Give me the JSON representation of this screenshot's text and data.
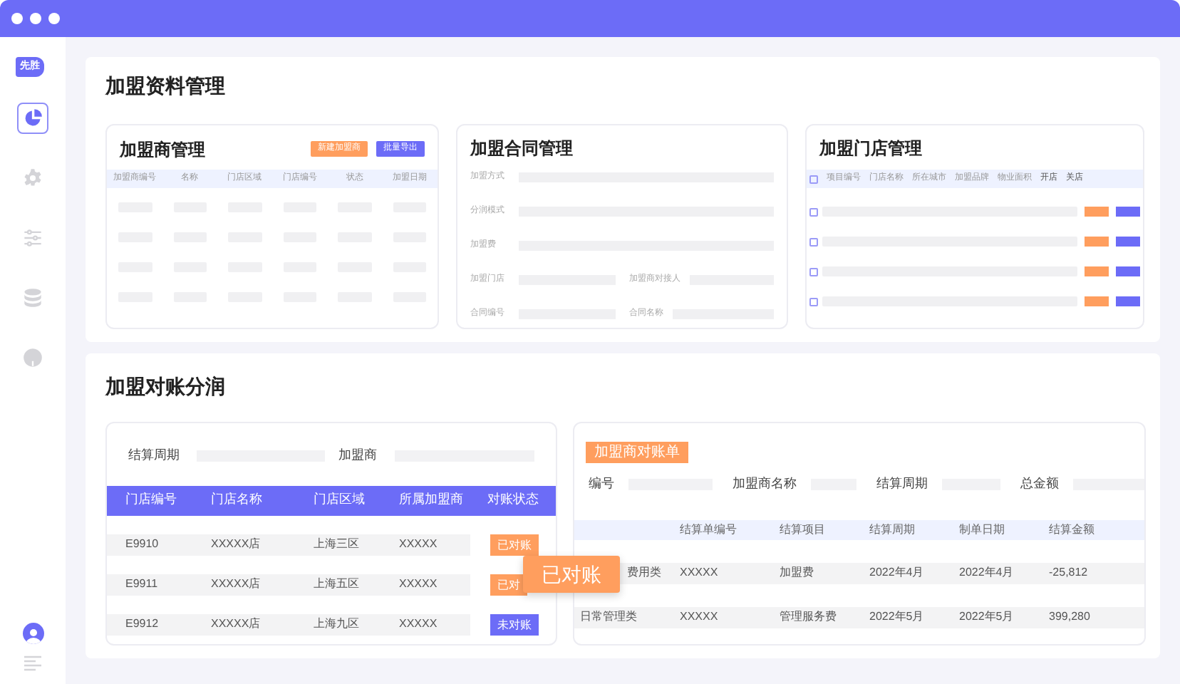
{
  "sidebar": {
    "logo": "先胜",
    "items": [
      {
        "selected": true
      },
      {
        "selected": false
      },
      {
        "selected": false
      },
      {
        "selected": false
      },
      {
        "selected": false
      }
    ]
  },
  "profile": {
    "selected": true
  },
  "section_1": {
    "title": "加盟资料管理",
    "franchisees": {
      "title": "加盟商管理",
      "buttons": [
        {
          "label": "新建加盟商",
          "kind": "secondary"
        },
        {
          "label": "批量导出",
          "kind": "primary"
        }
      ],
      "columns": [
        "加盟商编号",
        "名称",
        "门店区域",
        "门店编号",
        "状态",
        "加盟日期"
      ]
    },
    "contracts": {
      "title": "加盟合同管理",
      "fields": [
        [
          "加盟方式"
        ],
        [
          "分润模式"
        ],
        [
          "加盟费"
        ],
        [
          "加盟门店",
          "加盟商对接人"
        ],
        [
          "合同编号",
          "合同名称"
        ]
      ]
    },
    "stores": {
      "title": "加盟门店管理",
      "select_all": {
        "checked": false
      },
      "columns": [
        "项目编号",
        "门店名称",
        "所在城市",
        "加盟品牌",
        "物业面积",
        "开店",
        "关店"
      ],
      "rows": [
        {
          "checked": false
        },
        {
          "checked": false
        },
        {
          "checked": false
        },
        {
          "checked": false
        }
      ]
    }
  },
  "section_2": {
    "title": "加盟对账分润",
    "filters": [
      {
        "label": "结算周期"
      },
      {
        "label": "加盟商"
      }
    ],
    "table": {
      "columns": [
        "门店编号",
        "门店名称",
        "门店区域",
        "所属加盟商",
        "对账状态"
      ],
      "rows": [
        {
          "cells": [
            "E9910",
            "XXXXX店",
            "上海三区",
            "XXXXX"
          ],
          "status": {
            "label": "已对账",
            "kind": "reconciled"
          }
        },
        {
          "cells": [
            "E9911",
            "XXXXX店",
            "上海五区",
            "XXXXX"
          ],
          "status": {
            "label": "已对",
            "kind": "reconciled"
          }
        },
        {
          "cells": [
            "E9912",
            "XXXXX店",
            "上海九区",
            "XXXXX"
          ],
          "status": {
            "label": "未对账",
            "kind": "unreconciled"
          }
        }
      ]
    },
    "statement": {
      "title": "加盟商对账单",
      "fields": [
        "编号",
        "加盟商名称",
        "结算周期",
        "总金额"
      ],
      "columns": [
        "",
        "结算单编号",
        "结算项目",
        "结算周期",
        "制单日期",
        "结算金额"
      ],
      "rows": [
        [
          "费用类",
          "XXXXX",
          "加盟费",
          "2022年4月",
          "2022年4月",
          "-25,812"
        ],
        [
          "日常管理类",
          "XXXXX",
          "管理服务费",
          "2022年5月",
          "2022年5月",
          "399,280"
        ]
      ]
    },
    "drag_badge": "已对账"
  }
}
